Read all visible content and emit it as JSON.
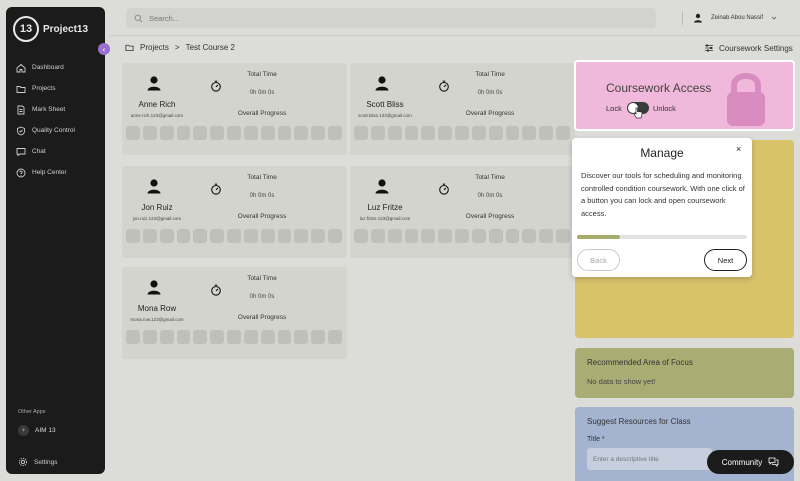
{
  "sidebar": {
    "logo_mark": "13",
    "app_name": "Project13",
    "collapse": "‹",
    "items": [
      {
        "label": "Dashboard",
        "icon": "home-icon"
      },
      {
        "label": "Projects",
        "icon": "folder-icon"
      },
      {
        "label": "Mark Sheet",
        "icon": "document-icon"
      },
      {
        "label": "Quality Control",
        "icon": "shield-icon"
      },
      {
        "label": "Chat",
        "icon": "chat-icon"
      },
      {
        "label": "Help Center",
        "icon": "help-icon"
      }
    ],
    "other_apps_label": "Other Apps",
    "aim_label": "AIM 13",
    "aim_icon": "+",
    "settings_label": "Settings"
  },
  "topbar": {
    "search_placeholder": "Search...",
    "user_name": "Zeinab Abou Nassif"
  },
  "breadcrumb": {
    "root": "Projects",
    "separator": ">",
    "current": "Test Course 2"
  },
  "coursework_settings_label": "Coursework Settings",
  "students": [
    {
      "name": "Anne Rich",
      "email": "anne.rich.123@gmail.com",
      "total_time_label": "Total Time",
      "total_time": "0h 0m 0s",
      "progress_label": "Overall Progress"
    },
    {
      "name": "Scott Bliss",
      "email": "scott.bliss.123@gmail.com",
      "total_time_label": "Total Time",
      "total_time": "0h 0m 0s",
      "progress_label": "Overall Progress"
    },
    {
      "name": "Jon Ruiz",
      "email": "jon.ruiz.123@gmail.com",
      "total_time_label": "Total Time",
      "total_time": "0h 0m 0s",
      "progress_label": "Overall Progress"
    },
    {
      "name": "Luz Fritze",
      "email": "luz.fritze.123@gmail.com",
      "total_time_label": "Total Time",
      "total_time": "0h 0m 0s",
      "progress_label": "Overall Progress"
    },
    {
      "name": "Mona Row",
      "email": "mona.row.123@gmail.com",
      "total_time_label": "Total Time",
      "total_time": "0h 0m 0s",
      "progress_label": "Overall Progress"
    }
  ],
  "coursework_access": {
    "title": "Coursework Access",
    "lock_label": "Lock",
    "unlock_label": "Unlock",
    "bg_color": "#f0b8da"
  },
  "recommended": {
    "title": "Recommended Area of Focus",
    "empty_text": "No data to show yet!"
  },
  "resources": {
    "title": "Suggest Resources for Class",
    "field_label": "Title *",
    "field_placeholder": "Enter a descriptive title"
  },
  "manage_popup": {
    "title": "Manage",
    "close": "×",
    "text": "Discover our tools for scheduling and monitoring controlled condition coursework. With one click of a button you can lock and open coursework access.",
    "progress_fraction": 0.25,
    "back_label": "Back",
    "next_label": "Next"
  },
  "community_label": "Community"
}
